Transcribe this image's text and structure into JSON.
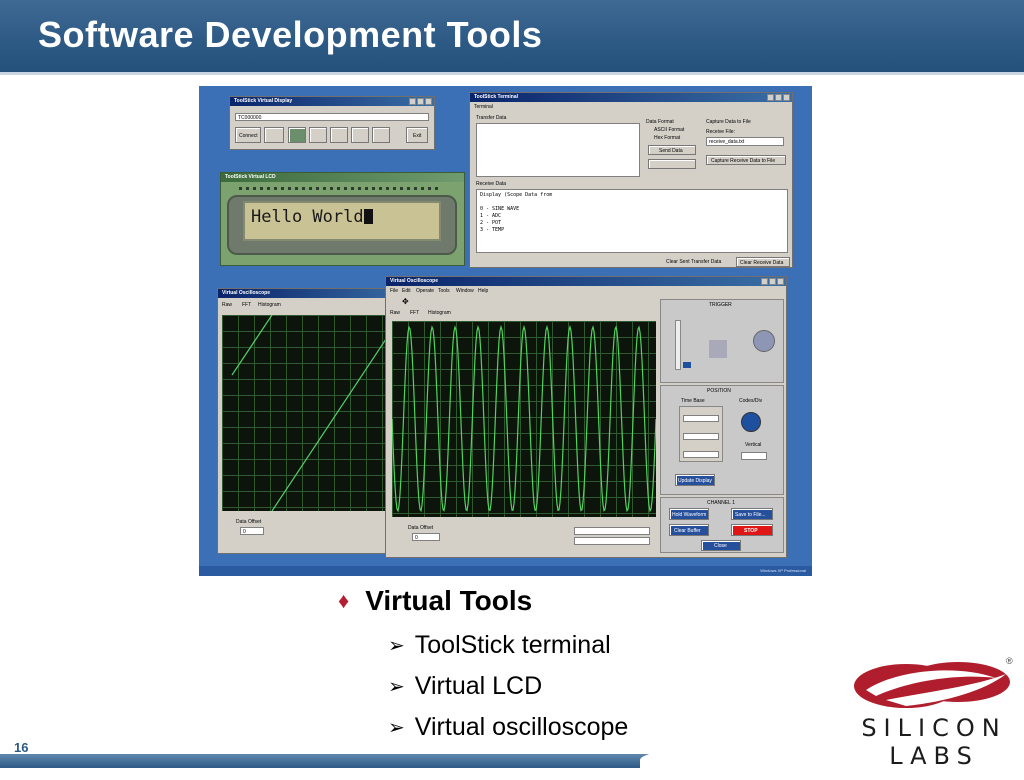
{
  "slide": {
    "title": "Software Development Tools",
    "page_number": "16",
    "colors": {
      "header": "#2e5a86",
      "bullet_diamond": "#b41e32",
      "logo_red": "#b01e2d"
    }
  },
  "bullets": {
    "main": "Virtual Tools",
    "diamond_icon": "♦",
    "arrow_icon": "➢",
    "sub": [
      "ToolStick terminal",
      "Virtual LCD",
      "Virtual oscilloscope"
    ]
  },
  "logo": {
    "text": "SILICON LABS",
    "registered": "®"
  },
  "screenshot": {
    "terminal": {
      "title": "ToolStick Terminal",
      "menu": "Terminal",
      "transfer_label": "Transfer Data",
      "data_format_label": "Data Format",
      "ascii_option": "ASCII Format",
      "hex_option": "Hex Format",
      "send_button": "Send Data",
      "capture_label": "Capture Data to File",
      "receive_file_label": "Receive File:",
      "receive_file_value": "receive_data.txt",
      "capture_button": "Capture Receive Data to File",
      "receive_label": "Receive Data",
      "receive_lines": [
        "Display (Scope Data from",
        "",
        "0 - SINE WAVE",
        "1 - ADC",
        "2 - POT",
        "3 - TEMP"
      ],
      "clear_after_label": "Clear Sent Transfer Data",
      "clear_receive_button": "Clear Receive Data"
    },
    "connect_panel": {
      "title": "ToolStick Virtual Display",
      "device_value": "TC000000",
      "connect_button": "Connect",
      "exit_button": "Exit"
    },
    "lcd": {
      "title": "ToolStick Virtual LCD",
      "text": "Hello World"
    },
    "scope_back": {
      "title": "Virtual Oscilloscope",
      "tabs": [
        "Raw",
        "FFT",
        "Histogram"
      ],
      "offset_label": "Data Offset",
      "offset_value": "0"
    },
    "scope_front": {
      "title": "Virtual Oscilloscope",
      "menu": [
        "File",
        "Edit",
        "Operate",
        "Tools",
        "Window",
        "Help"
      ],
      "tabs": [
        "Raw",
        "FFT",
        "Histogram"
      ],
      "trigger_label": "TRIGGER",
      "position_label": "POSITION",
      "time_base_label": "Time Base",
      "codes_div_label": "Codes/Div",
      "vertical_label": "Vertical",
      "update_button": "Update Display",
      "channel_label": "CHANNEL 1",
      "hold_button": "Hold Waveform",
      "save_button": "Save to File...",
      "clear_button": "Clear Buffer",
      "stop_button": "STOP",
      "close_button": "Close",
      "offset_label": "Data Offset",
      "offset_value": "0"
    },
    "status": "Windows XP Professional"
  }
}
